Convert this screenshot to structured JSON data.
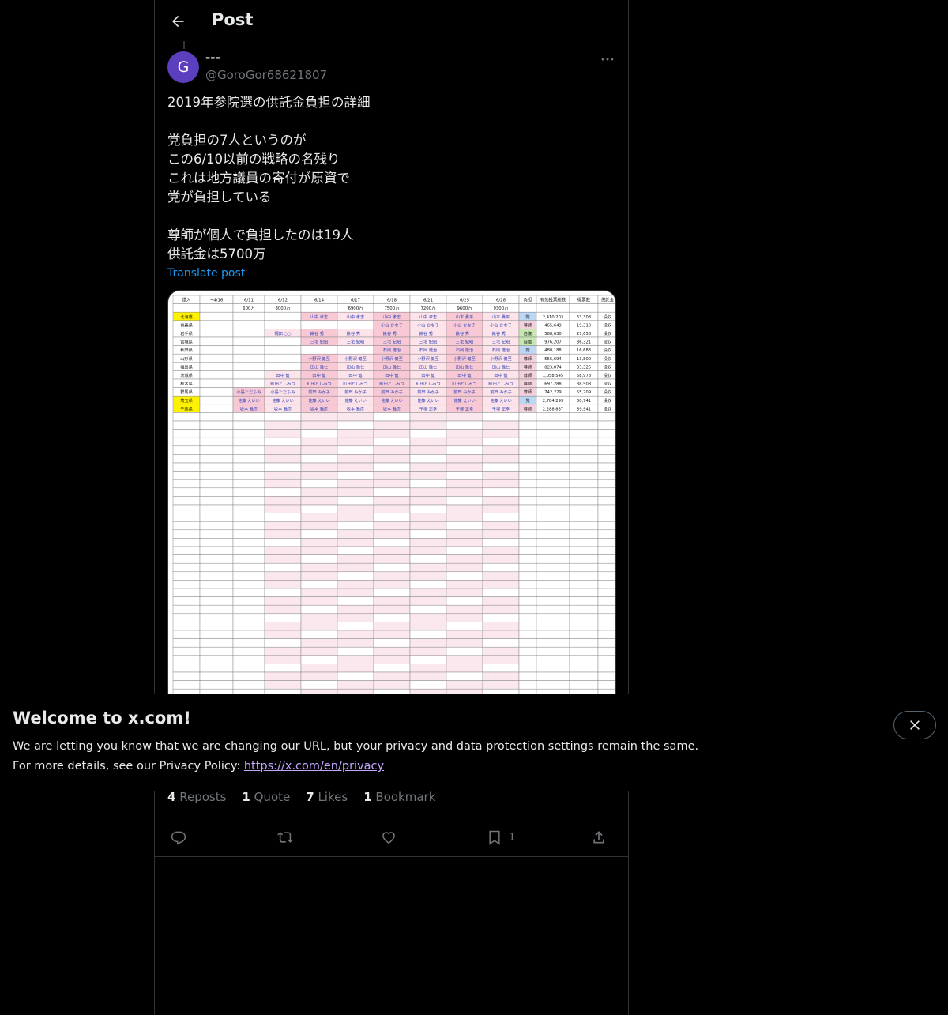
{
  "header": {
    "title": "Post"
  },
  "post": {
    "name": "---",
    "handle": "@GoroGor68621807",
    "avatar_letter": "G",
    "text": "2019年参院選の供託金負担の詳細\n\n党負担の7人というのが\nこの6/10以前の戦略の名残り\nこれは地方議員の寄付が原資で\n党が負担している\n\n尊師が個人で負担したのは19人\n供託金は5700万",
    "translate_label": "Translate post"
  },
  "image_table": {
    "header": [
      "借入",
      "~4/16",
      "6/11",
      "6/12",
      "6/14",
      "6/17",
      "6/18",
      "6/21",
      "6/25",
      "6/28",
      "負担",
      "有効投票総数",
      "得票数",
      "供託金"
    ],
    "subheader": [
      "",
      "",
      "600万",
      "3000万",
      "",
      "6900万",
      "7500万",
      "7200万",
      "9600万",
      "9300万",
      "",
      "",
      "",
      ""
    ],
    "rows": [
      [
        "北海道",
        "",
        "",
        "",
        "山中 孝志",
        "山中 孝志",
        "山中 孝志",
        "山中 孝志",
        "山本 貴平",
        "山本 貴平",
        "党",
        "2,410,203",
        "63,308",
        "没収"
      ],
      [
        "青森県",
        "",
        "",
        "",
        "",
        "",
        "小山 ひな子",
        "小山 ひな子",
        "小山 ひな子",
        "小山 ひな子",
        "尊師",
        "465,649",
        "19,310",
        "没収"
      ],
      [
        "岩手県",
        "",
        "",
        "梶田 ○○",
        "鍬谷 秀一",
        "鍬谷 秀一",
        "鍬谷 秀一",
        "鍬谷 秀一",
        "鍬谷 秀一",
        "鍬谷 秀一",
        "自腹",
        "588,630",
        "27,658",
        "没収"
      ],
      [
        "宮城県",
        "",
        "",
        "",
        "三宅 紀昭",
        "三宅 紀昭",
        "三宅 紀昭",
        "三宅 紀昭",
        "三宅 紀昭",
        "三宅 紀昭",
        "自腹",
        "976,207",
        "36,321",
        "没収"
      ],
      [
        "秋田県",
        "",
        "",
        "",
        "",
        "",
        "石岡 隆治",
        "石岡 隆治",
        "石岡 隆治",
        "石岡 隆治",
        "党",
        "480,188",
        "16,683",
        "没収"
      ],
      [
        "山形県",
        "",
        "",
        "",
        "小野沢 健至",
        "小野沢 健至",
        "小野沢 健至",
        "小野沢 健至",
        "小野沢 健至",
        "小野沢 健至",
        "尊師",
        "556,694",
        "13,800",
        "没収"
      ],
      [
        "福島県",
        "",
        "",
        "",
        "田山 雅仁",
        "田山 雅仁",
        "田山 雅仁",
        "田山 雅仁",
        "田山 雅仁",
        "田山 雅仁",
        "尊師",
        "823,874",
        "33,326",
        "没収"
      ],
      [
        "茨城県",
        "",
        "",
        "田中 健",
        "田中 健",
        "田中 健",
        "田中 健",
        "田中 健",
        "田中 健",
        "田中 健",
        "尊師",
        "1,058,545",
        "58,978",
        "没収"
      ],
      [
        "栃木県",
        "",
        "",
        "町田としみつ",
        "町田としみつ",
        "町田としみつ",
        "町田としみつ",
        "町田としみつ",
        "町田としみつ",
        "町田としみつ",
        "尊師",
        "697,288",
        "38,508",
        "没収"
      ],
      [
        "群馬県",
        "",
        "小島ただふみ",
        "小島ただふみ",
        "前田 みか子",
        "前田 みか子",
        "前田 みか子",
        "前田 みか子",
        "前田 みか子",
        "前田 みか子",
        "尊師",
        "742,229",
        "55,209",
        "没収"
      ],
      [
        "埼玉県",
        "",
        "佐藤 えいい",
        "佐藤 えいい",
        "佐藤 えいい",
        "佐藤 えいい",
        "佐藤 えいい",
        "佐藤 えいい",
        "佐藤 えいい",
        "佐藤 えいい",
        "党",
        "2,784,299",
        "80,741",
        "没収"
      ],
      [
        "千葉県",
        "",
        "坂本 雅彦",
        "坂本 雅彦",
        "坂本 雅彦",
        "坂本 雅彦",
        "坂本 雅彦",
        "平塚 正幸",
        "平塚 正幸",
        "平塚 正幸",
        "尊師",
        "2,288,837",
        "89,941",
        "没収"
      ]
    ]
  },
  "stats": [
    {
      "count": "4",
      "label": "Reposts"
    },
    {
      "count": "1",
      "label": "Quote"
    },
    {
      "count": "7",
      "label": "Likes"
    },
    {
      "count": "1",
      "label": "Bookmark"
    }
  ],
  "actions": {
    "bookmark_count": "1"
  },
  "banner": {
    "title": "Welcome to x.com!",
    "line1": "We are letting you know that we are changing our URL, but your privacy and data protection settings remain the same.",
    "line2_prefix": "For more details, see our Privacy Policy: ",
    "link": "https://x.com/en/privacy"
  },
  "colors": {
    "accent": "#1d9bf0",
    "avatar": "#5b3fbf",
    "link": "#c4a7ff",
    "yellow_cell": "#fff200",
    "pink_cell": "#f8c9d4",
    "green_cell": "#c6e8b0",
    "blue_cell": "#bcd6f5"
  }
}
